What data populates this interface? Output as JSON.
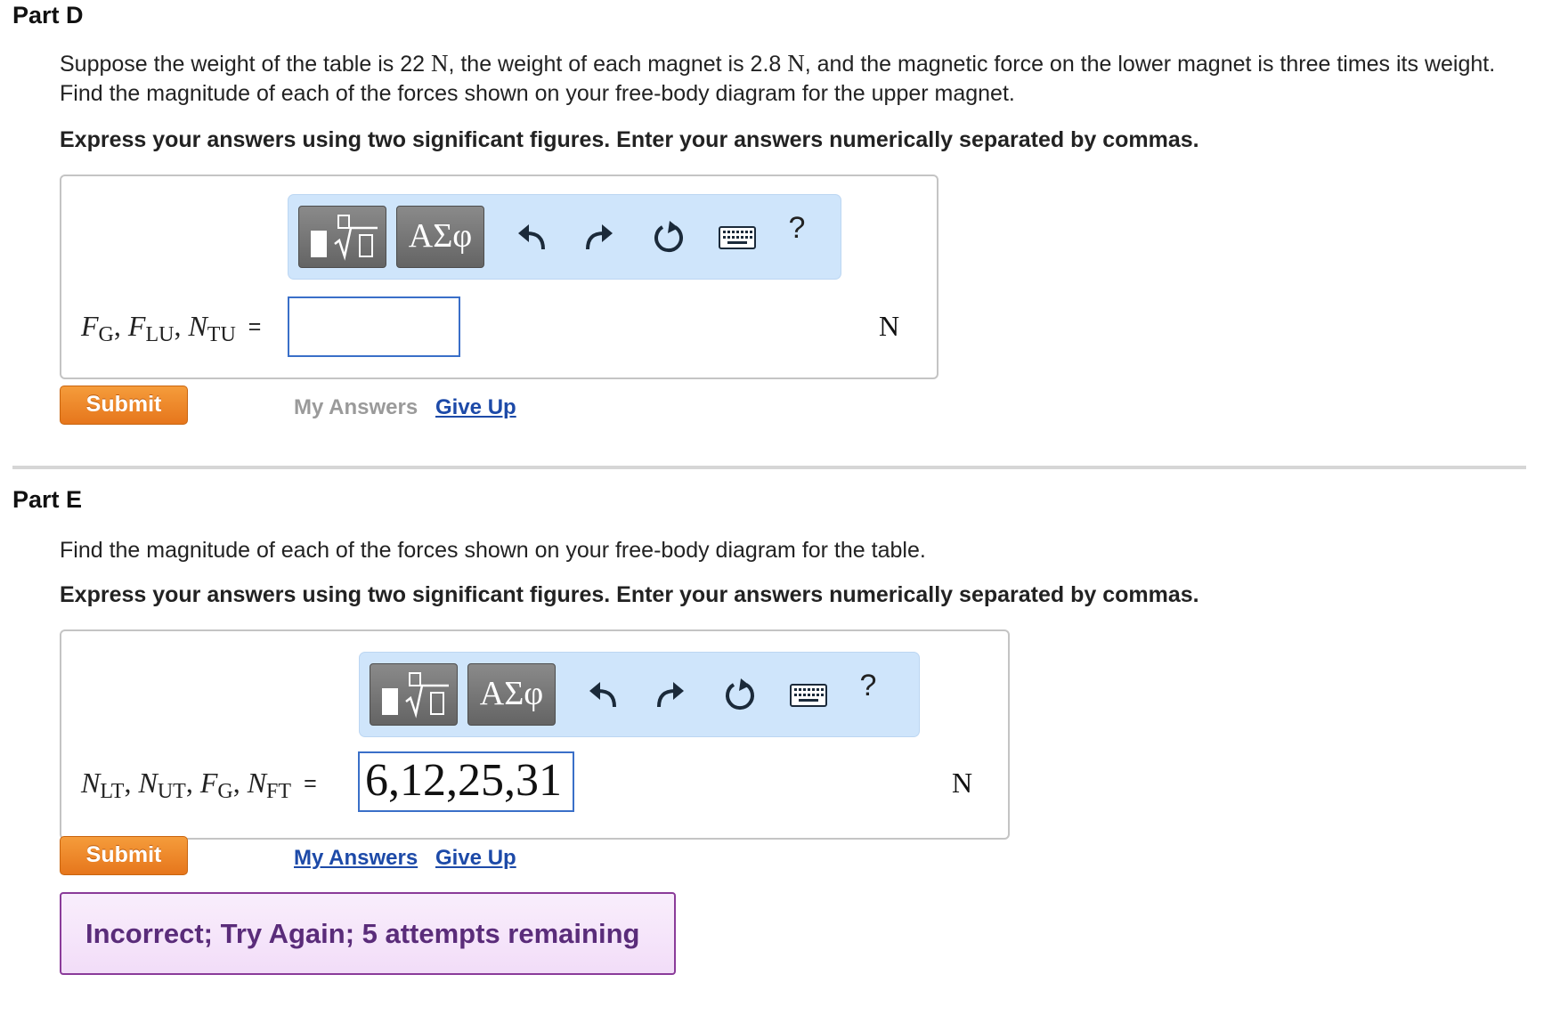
{
  "part_d": {
    "title": "Part D",
    "prompt_before_1": "Suppose the weight of the table is 22",
    "prompt_unit_1": "N",
    "prompt_before_2": ", the weight of each magnet is 2.8",
    "prompt_unit_2": "N",
    "prompt_after": ", and the magnetic force on the lower magnet is three times its weight. Find the magnitude of each of the forces shown on your free-body diagram for the upper magnet.",
    "instruction": "Express your answers using two significant figures. Enter your answers numerically separated by commas.",
    "toolbar": {
      "symbols_label": "ΑΣφ",
      "help_label": "?"
    },
    "label": {
      "v1": "F",
      "s1": "G",
      "v2": "F",
      "s2": "LU",
      "v3": "N",
      "s3": "TU",
      "equals": "="
    },
    "input_value": "",
    "unit": "N",
    "submit_label": "Submit",
    "my_answers_label": "My Answers",
    "give_up_label": "Give Up"
  },
  "part_e": {
    "title": "Part E",
    "prompt": "Find the magnitude of each of the forces shown on your free-body diagram for the table.",
    "instruction": "Express your answers using two significant figures. Enter your answers numerically separated by commas.",
    "toolbar": {
      "symbols_label": "ΑΣφ",
      "help_label": "?"
    },
    "label": {
      "v1": "N",
      "s1": "LT",
      "v2": "N",
      "s2": "UT",
      "v3": "F",
      "s3": "G",
      "v4": "N",
      "s4": "FT",
      "equals": "="
    },
    "input_value": "6,12,25,31",
    "unit": "N",
    "submit_label": "Submit",
    "my_answers_label": "My Answers",
    "give_up_label": "Give Up",
    "feedback": "Incorrect; Try Again; 5 attempts remaining"
  },
  "colors": {
    "submit": "#e6761c",
    "toolbar_bg": "#cfe5fb",
    "link": "#1d4aa8",
    "feedback_border": "#8a3b99"
  },
  "icons": {
    "templates": "templates-icon",
    "undo": "undo-icon",
    "redo": "redo-icon",
    "reset": "reset-icon",
    "keyboard": "keyboard-icon",
    "help": "help-icon"
  }
}
